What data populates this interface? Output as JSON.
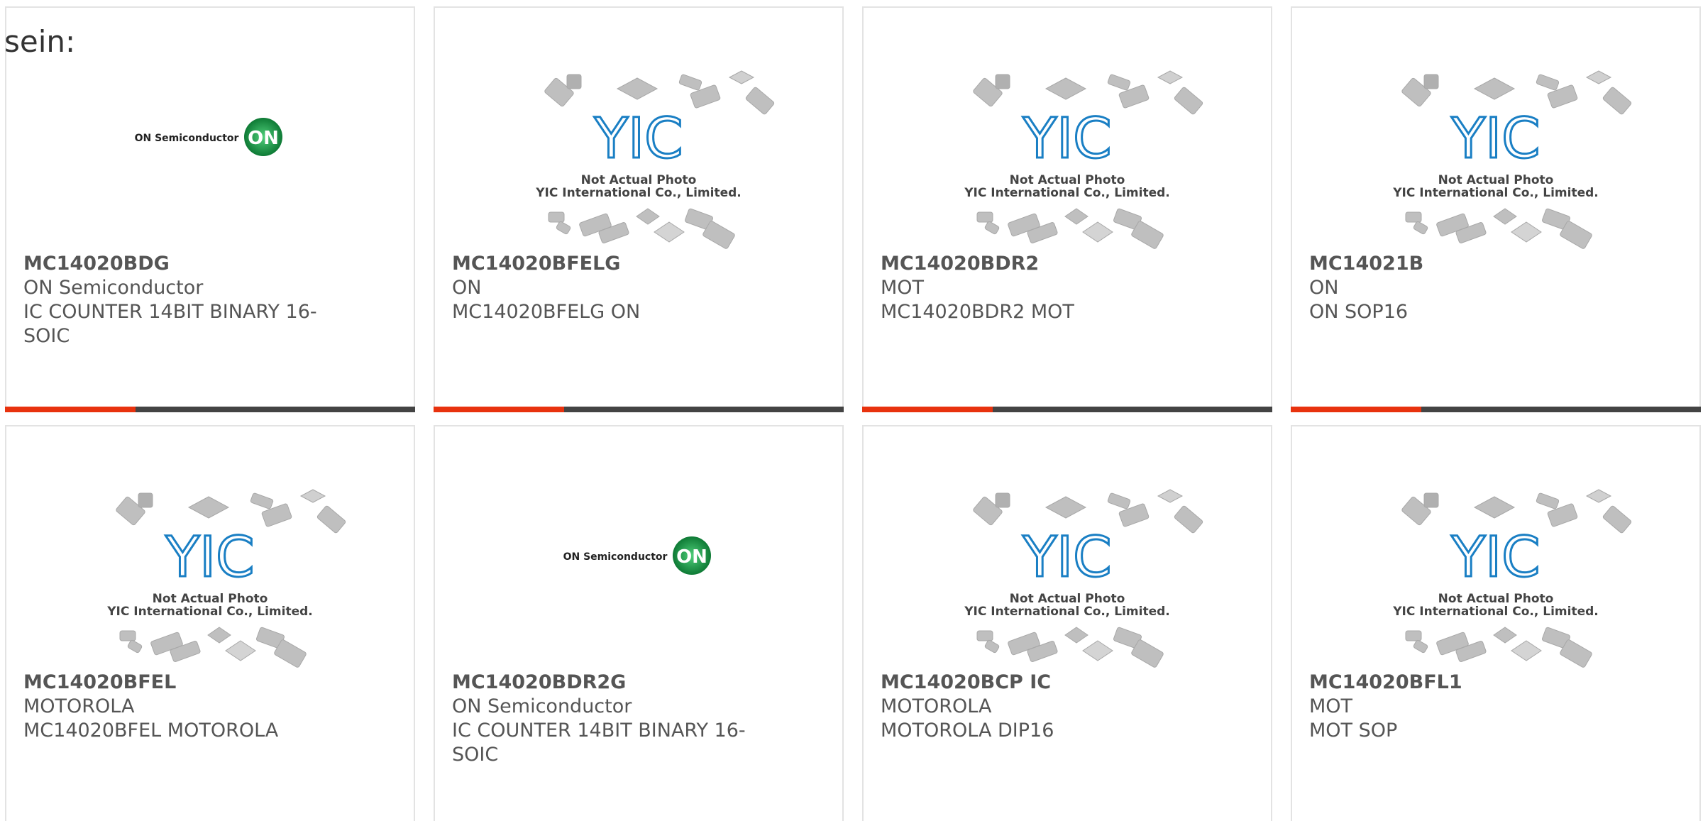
{
  "page": {
    "prefix_text": "sein:"
  },
  "placeholder_image": {
    "line1": "Not Actual Photo",
    "line2": "YIC International Co., Limited.",
    "logo_text": "YIC"
  },
  "onsemi_logo": {
    "wordmark": "ON Semiconductor",
    "badge": "ON"
  },
  "colors": {
    "accent": "#e8320e",
    "bar_dark": "#444444",
    "on_green": "#1a9a4a",
    "yic_blue": "#1a7fc4"
  },
  "products": [
    {
      "part": "MC14020BDG",
      "maker": "ON Semiconductor",
      "desc": "IC COUNTER 14BIT BINARY 16-",
      "desc2": "SOIC",
      "image": "onsemi-logo"
    },
    {
      "part": "MC14020BFELG",
      "maker": "ON",
      "desc": "MC14020BFELG ON",
      "desc2": "",
      "image": "yic-placeholder"
    },
    {
      "part": "MC14020BDR2",
      "maker": "MOT",
      "desc": "MC14020BDR2 MOT",
      "desc2": "",
      "image": "yic-placeholder"
    },
    {
      "part": "MC14021B",
      "maker": "ON",
      "desc": "ON SOP16",
      "desc2": "",
      "image": "yic-placeholder"
    },
    {
      "part": "MC14020BFEL",
      "maker": "MOTOROLA",
      "desc": "MC14020BFEL MOTOROLA",
      "desc2": "",
      "image": "yic-placeholder"
    },
    {
      "part": "MC14020BDR2G",
      "maker": "ON Semiconductor",
      "desc": "IC COUNTER 14BIT BINARY 16-",
      "desc2": "SOIC",
      "image": "onsemi-logo"
    },
    {
      "part": "MC14020BCP IC",
      "maker": "MOTOROLA",
      "desc": "MOTOROLA DIP16",
      "desc2": "",
      "image": "yic-placeholder"
    },
    {
      "part": "MC14020BFL1",
      "maker": "MOT",
      "desc": "MOT SOP",
      "desc2": "",
      "image": "yic-placeholder"
    }
  ]
}
